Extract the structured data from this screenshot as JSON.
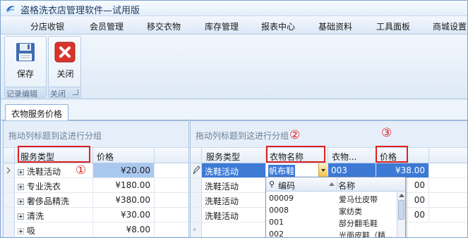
{
  "window": {
    "title": "盗格洗衣店管理软件—试用版"
  },
  "menu": {
    "items": [
      "分店收银",
      "会员管理",
      "移交衣物",
      "库存管理",
      "报表中心",
      "基础资料",
      "工具面板",
      "商城设置"
    ]
  },
  "ribbon": {
    "save_label": "保存",
    "close_label": "关闭",
    "group_record_label": "记录编辑",
    "group_close_label": "关闭"
  },
  "tabs": {
    "active": "衣物服务价格"
  },
  "left_grid": {
    "group_hint": "拖动列标题到这进行分组",
    "columns": [
      "服务类型",
      "价格"
    ],
    "rows": [
      {
        "type": "洗鞋活动",
        "price": "¥20.00"
      },
      {
        "type": "专业洗衣",
        "price": "¥180.00"
      },
      {
        "type": "奢侈品精洗",
        "price": "¥380.00"
      },
      {
        "type": "清洗",
        "price": "¥30.00"
      },
      {
        "type": "吸",
        "price": "¥8.00"
      }
    ]
  },
  "right_grid": {
    "group_hint": "拖动列标题到这进行分组",
    "columns": [
      "服务类型",
      "衣物名称",
      "衣物...",
      "价格"
    ],
    "rows": [
      {
        "type": "洗鞋活动",
        "name": "帆布鞋",
        "code": "003",
        "price": "¥38.00"
      },
      {
        "type": "洗鞋活动",
        "name": "",
        "code": "",
        "price": "00"
      },
      {
        "type": "洗鞋活动",
        "name": "",
        "code": "",
        "price": "00"
      },
      {
        "type": "洗鞋活动",
        "name": "",
        "code": "",
        "price": "00"
      }
    ]
  },
  "dropdown": {
    "columns": [
      "编码",
      "名称"
    ],
    "items": [
      {
        "code": "00009",
        "name": "爱马仕皮带"
      },
      {
        "code": "0008",
        "name": "家纺类"
      },
      {
        "code": "001",
        "name": "部分翻毛鞋"
      },
      {
        "code": "002",
        "name": "光面皮鞋（精..."
      }
    ]
  },
  "annotations": [
    "①",
    "②",
    "③"
  ],
  "colors": {
    "selection": "#3d7ad6",
    "annotation": "#e02020",
    "chrome": "#dfeaf7"
  }
}
